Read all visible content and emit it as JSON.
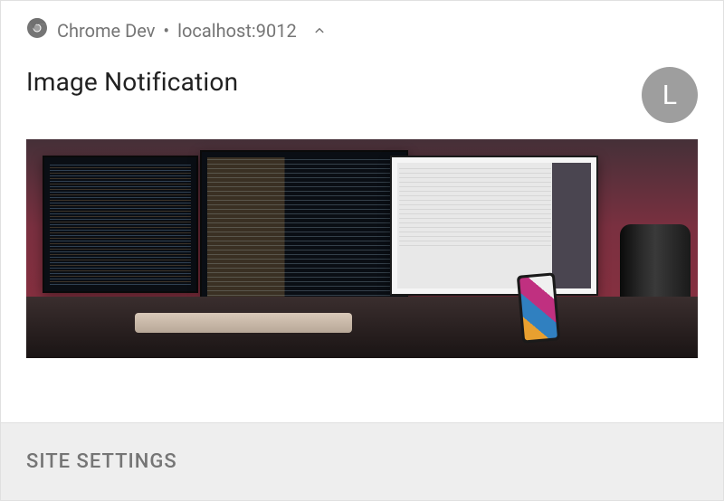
{
  "header": {
    "app_name": "Chrome Dev",
    "origin": "localhost:9012",
    "separator": "•"
  },
  "notification": {
    "title": "Image Notification",
    "avatar_letter": "L"
  },
  "actions": {
    "site_settings_label": "SITE SETTINGS"
  }
}
